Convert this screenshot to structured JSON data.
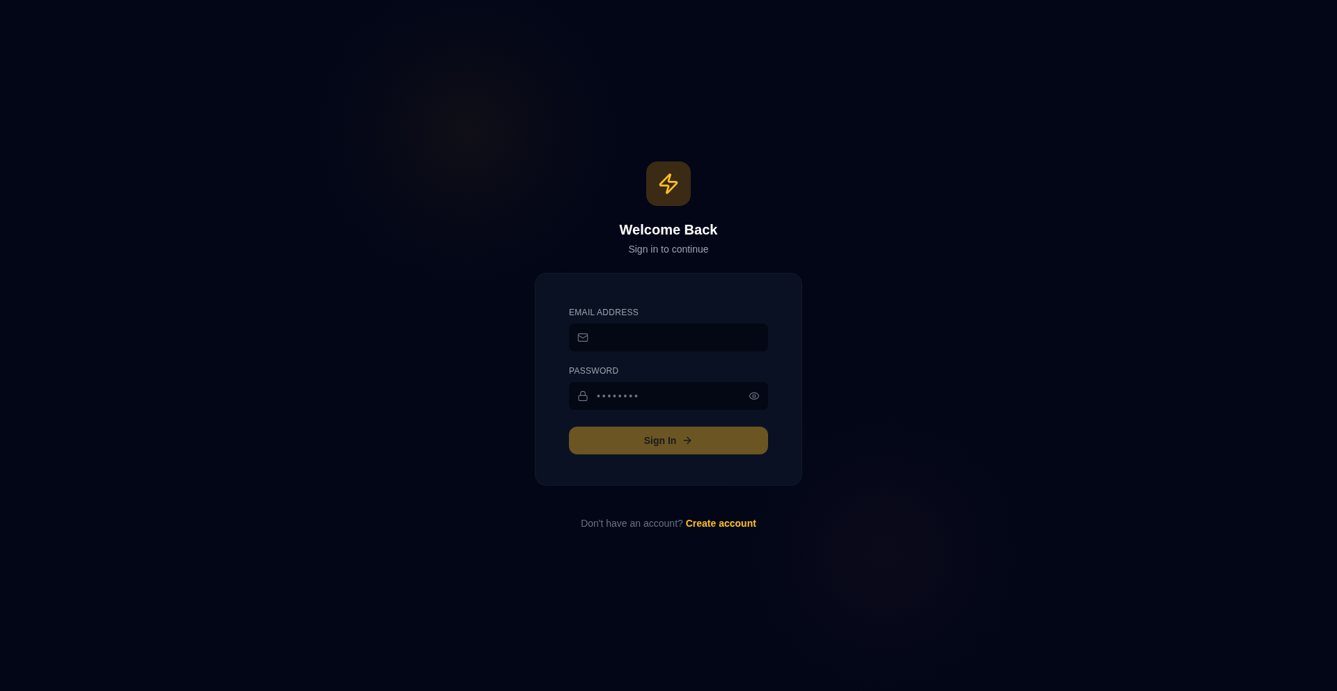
{
  "header": {
    "title": "Welcome Back",
    "subtitle": "Sign in to continue"
  },
  "form": {
    "fields": [
      {
        "kind": "email",
        "label": "EMAIL ADDRESS"
      },
      {
        "kind": "password",
        "label": "PASSWORD",
        "value": "••••••••"
      }
    ],
    "submit": {
      "label": "Sign In",
      "disabled": true
    }
  },
  "footer": {
    "prompt": "Don't have an account?",
    "link": "Create account"
  }
}
